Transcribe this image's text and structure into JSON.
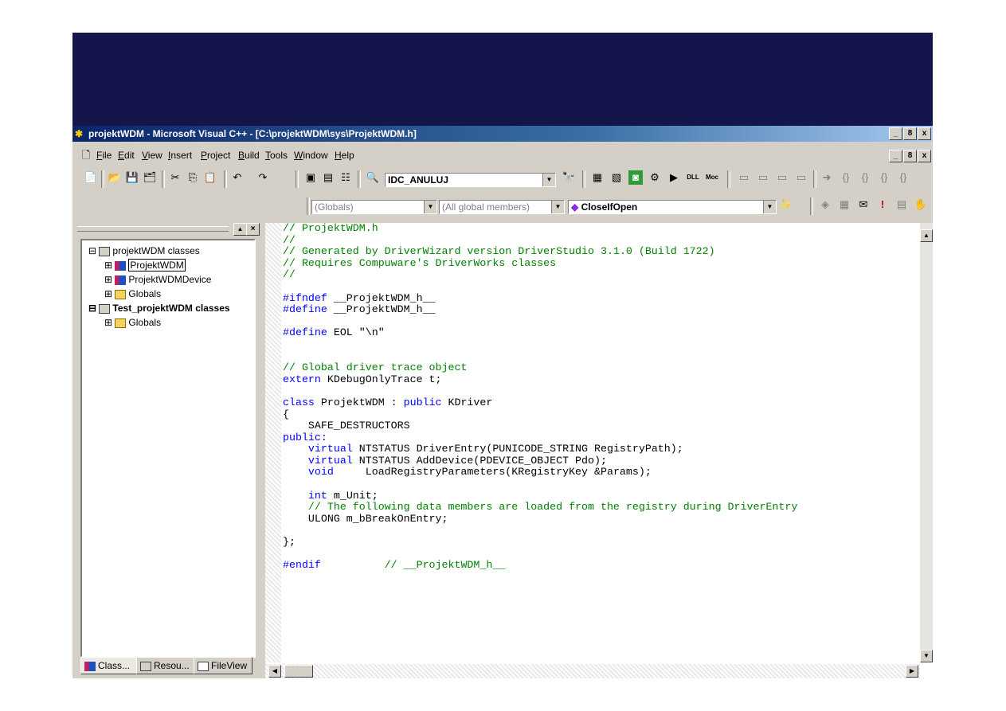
{
  "window": {
    "title": "projektWDM - Microsoft Visual C++ - [C:\\projektWDM\\sys\\ProjektWDM.h]",
    "controls": [
      "_",
      "8",
      "x"
    ]
  },
  "menu": {
    "items": [
      {
        "u": "F",
        "rest": "ile"
      },
      {
        "u": "E",
        "rest": "dit"
      },
      {
        "u": "V",
        "rest": "iew"
      },
      {
        "u": "I",
        "rest": "nsert"
      },
      {
        "u": "P",
        "rest": "roject"
      },
      {
        "u": "B",
        "rest": "uild"
      },
      {
        "u": "T",
        "rest": "ools"
      },
      {
        "u": "W",
        "rest": "indow"
      },
      {
        "u": "H",
        "rest": "elp"
      }
    ]
  },
  "toolbar": {
    "resource_id": "IDC_ANULUJ",
    "wizard_class": "(Globals)",
    "wizard_filter": "(All global members)",
    "wizard_member": "CloseIfOpen",
    "icons": {
      "new": "📄",
      "open": "📂",
      "save": "💾",
      "save_all": "🗂",
      "cut": "✂",
      "copy": "⎘",
      "paste": "📋",
      "undo": "↶",
      "redo": "↷",
      "workspace": "▣",
      "output": "▤",
      "window_list": "☷",
      "find_in_files": "🔍",
      "find": "🔭",
      "compile": "▦",
      "build": "▧",
      "stop": "◙",
      "run": "⚙",
      "go": "▶",
      "dll": "DLL",
      "moc": "Moc",
      "bp1": "▭",
      "bp2": "▭",
      "bp3": "▭",
      "bp4": "▭",
      "arrow": "➜",
      "step1": "{}",
      "step2": "{}",
      "step3": "{}",
      "step4": "{}",
      "wand": "✨",
      "a1": "◈",
      "a2": "▦",
      "a3": "✉",
      "exclaim": "!",
      "a4": "▤",
      "hand": "✋"
    }
  },
  "workspace": {
    "tree": [
      {
        "label": "projektWDM classes",
        "expander": "⊟",
        "icon": "proj"
      },
      {
        "label": "ProjektWDM",
        "expander": "⊞",
        "icon": "cls"
      },
      {
        "label": "ProjektWDMDevice",
        "expander": "⊞",
        "icon": "cls"
      },
      {
        "label": "Globals",
        "expander": "⊞",
        "icon": "folder"
      },
      {
        "label": "Test_projektWDM classes",
        "expander": "⊟",
        "icon": "proj"
      },
      {
        "label": "Globals",
        "expander": "⊞",
        "icon": "folder"
      }
    ],
    "tabs": [
      "Class...",
      "Resou...",
      "FileView"
    ]
  },
  "editor": {
    "lines": [
      [
        {
          "t": "// ProjektWDM.h",
          "c": "cm"
        }
      ],
      [
        {
          "t": "//",
          "c": "cm"
        }
      ],
      [
        {
          "t": "// Generated by DriverWizard version DriverStudio 3.1.0 (Build 1722)",
          "c": "cm"
        }
      ],
      [
        {
          "t": "// Requires Compuware's DriverWorks classes",
          "c": "cm"
        }
      ],
      [
        {
          "t": "//",
          "c": "cm"
        }
      ],
      [],
      [
        {
          "t": "#ifndef",
          "c": "kw"
        },
        {
          "t": " __ProjektWDM_h__",
          "c": ""
        }
      ],
      [
        {
          "t": "#define",
          "c": "kw"
        },
        {
          "t": " __ProjektWDM_h__",
          "c": ""
        }
      ],
      [],
      [
        {
          "t": "#define",
          "c": "kw"
        },
        {
          "t": " EOL \"\\n\"",
          "c": ""
        }
      ],
      [],
      [],
      [
        {
          "t": "// Global driver trace object",
          "c": "cm"
        }
      ],
      [
        {
          "t": "extern",
          "c": "kw"
        },
        {
          "t": " KDebugOnlyTrace t;",
          "c": ""
        }
      ],
      [],
      [
        {
          "t": "class",
          "c": "kw"
        },
        {
          "t": " ProjektWDM : ",
          "c": ""
        },
        {
          "t": "public",
          "c": "kw"
        },
        {
          "t": " KDriver",
          "c": ""
        }
      ],
      [
        {
          "t": "{",
          "c": ""
        }
      ],
      [
        {
          "t": "    SAFE_DESTRUCTORS",
          "c": ""
        }
      ],
      [
        {
          "t": "public:",
          "c": "kw"
        }
      ],
      [
        {
          "t": "    ",
          "c": ""
        },
        {
          "t": "virtual",
          "c": "kw"
        },
        {
          "t": " NTSTATUS DriverEntry(PUNICODE_STRING RegistryPath);",
          "c": ""
        }
      ],
      [
        {
          "t": "    ",
          "c": ""
        },
        {
          "t": "virtual",
          "c": "kw"
        },
        {
          "t": " NTSTATUS AddDevice(PDEVICE_OBJECT Pdo);",
          "c": ""
        }
      ],
      [
        {
          "t": "    ",
          "c": ""
        },
        {
          "t": "void",
          "c": "kw"
        },
        {
          "t": "     LoadRegistryParameters(KRegistryKey &Params);",
          "c": ""
        }
      ],
      [],
      [
        {
          "t": "    ",
          "c": ""
        },
        {
          "t": "int",
          "c": "kw"
        },
        {
          "t": " m_Unit;",
          "c": ""
        }
      ],
      [
        {
          "t": "    // The following data members are loaded from the registry during DriverEntry",
          "c": "cm"
        }
      ],
      [
        {
          "t": "    ULONG m_bBreakOnEntry;",
          "c": ""
        }
      ],
      [],
      [
        {
          "t": "};",
          "c": ""
        }
      ],
      [],
      [
        {
          "t": "#endif",
          "c": "kw"
        },
        {
          "t": "          ",
          "c": ""
        },
        {
          "t": "// __ProjektWDM_h__",
          "c": "cm"
        }
      ]
    ]
  }
}
